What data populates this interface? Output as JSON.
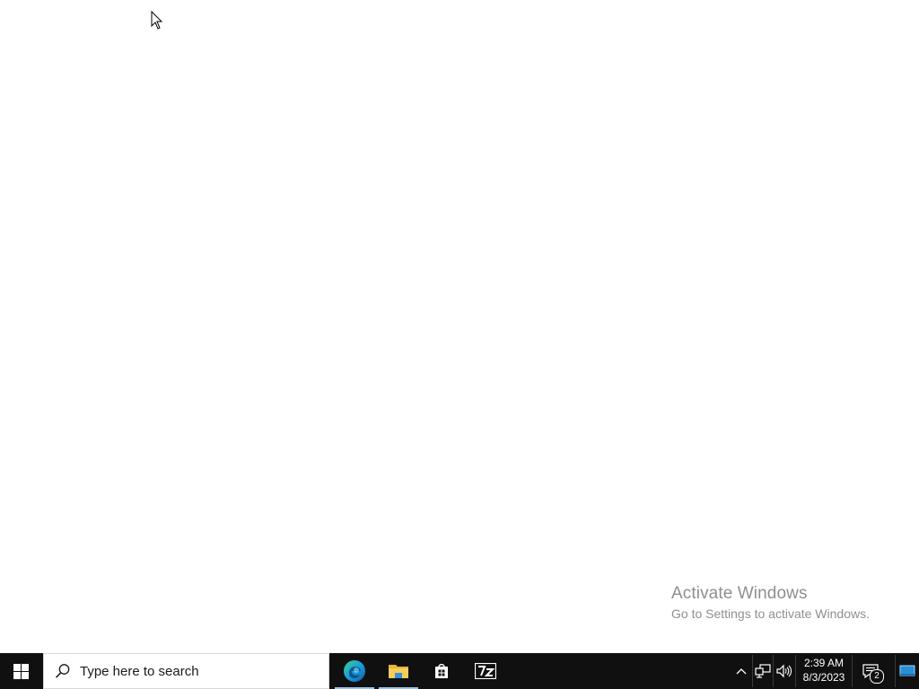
{
  "desktop": {
    "watermark": {
      "title": "Activate Windows",
      "subtitle": "Go to Settings to activate Windows."
    }
  },
  "taskbar": {
    "start": {
      "icon": "windows-logo-icon"
    },
    "search": {
      "placeholder": "Type here to search",
      "icon": "search-icon"
    },
    "apps": [
      {
        "name": "Microsoft Edge",
        "icon": "edge-icon",
        "active": true
      },
      {
        "name": "File Explorer",
        "icon": "folder-icon",
        "active": true
      },
      {
        "name": "Microsoft Store",
        "icon": "store-icon",
        "active": false
      },
      {
        "name": "7-Zip",
        "icon": "7zip-icon",
        "label": "7z",
        "active": false
      }
    ],
    "tray": {
      "overflow_icon": "chevron-up-icon",
      "network_icon": "network-icon",
      "volume_icon": "volume-icon",
      "time": "2:39 AM",
      "date": "8/3/2023",
      "notifications": {
        "icon": "action-center-icon",
        "count": "2"
      },
      "show_desktop_icon": "show-desktop-icon"
    },
    "colors": {
      "background": "#101010",
      "accent_underline": "#9ec3e6",
      "edge_blue": "#1a8fd6",
      "edge_green": "#38c172",
      "folder_yellow": "#f4c84c"
    }
  }
}
